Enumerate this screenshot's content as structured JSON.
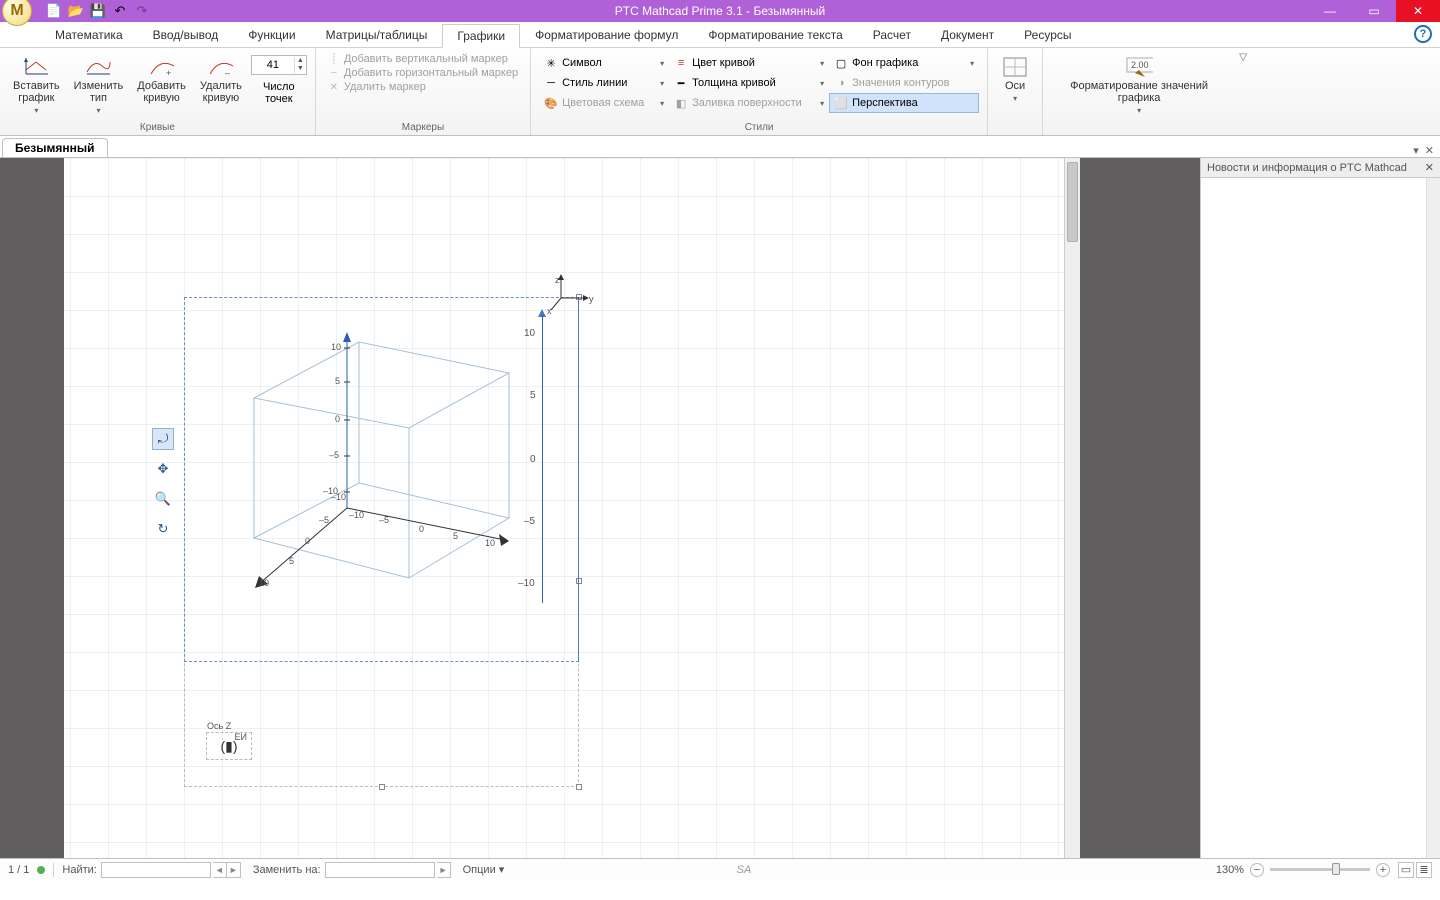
{
  "title": "PTC Mathcad Prime 3.1 - Безымянный",
  "tabs": [
    "Математика",
    "Ввод/вывод",
    "Функции",
    "Матрицы/таблицы",
    "Графики",
    "Форматирование формул",
    "Форматирование текста",
    "Расчет",
    "Документ",
    "Ресурсы"
  ],
  "active_tab_index": 4,
  "ribbon": {
    "curves": {
      "insert_graph": "Вставить\nграфик",
      "change_type": "Изменить\nтип",
      "add_curve": "Добавить\nкривую",
      "delete_curve": "Удалить\nкривую",
      "points_label": "Число\nточек",
      "points_value": "41",
      "group_label": "Кривые"
    },
    "markers": {
      "add_v": "Добавить вертикальный маркер",
      "add_h": "Добавить горизонтальный маркер",
      "del": "Удалить маркер",
      "group_label": "Маркеры"
    },
    "styles": {
      "items_left": [
        "Символ",
        "Стиль линии",
        "Цветовая схема",
        "Перспектива"
      ],
      "items_right": [
        "Цвет кривой",
        "Толщина кривой",
        "Заливка поверхности",
        "Фон графика",
        "Значения контуров"
      ],
      "group_label": "Стили"
    },
    "axes": {
      "label": "Оси"
    },
    "format_values": {
      "label": "Форматирование значений графика"
    }
  },
  "doc_tab": "Безымянный",
  "news_panel": {
    "title": "Новости и информация о PTC Mathcad"
  },
  "plot": {
    "z_label": "Ось Z",
    "unit_label": "ЕИ",
    "cube_ticks": [
      "10",
      "5",
      "0",
      "–5",
      "–10"
    ],
    "axes_key": {
      "x": "x",
      "y": "y",
      "z": "z"
    }
  },
  "statusbar": {
    "page": "1 / 1",
    "find_label": "Найти:",
    "replace_label": "Заменить на:",
    "options_label": "Опции",
    "zoom": "130%"
  }
}
